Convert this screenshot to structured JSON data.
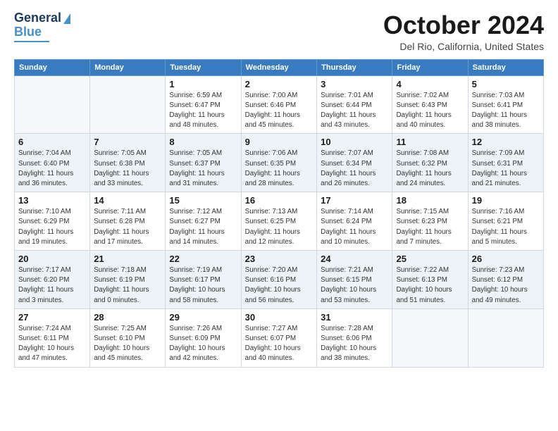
{
  "logo": {
    "line1": "General",
    "line2": "Blue"
  },
  "title": "October 2024",
  "location": "Del Rio, California, United States",
  "days_of_week": [
    "Sunday",
    "Monday",
    "Tuesday",
    "Wednesday",
    "Thursday",
    "Friday",
    "Saturday"
  ],
  "weeks": [
    [
      {
        "day": "",
        "info": ""
      },
      {
        "day": "",
        "info": ""
      },
      {
        "day": "1",
        "info": "Sunrise: 6:59 AM\nSunset: 6:47 PM\nDaylight: 11 hours and 48 minutes."
      },
      {
        "day": "2",
        "info": "Sunrise: 7:00 AM\nSunset: 6:46 PM\nDaylight: 11 hours and 45 minutes."
      },
      {
        "day": "3",
        "info": "Sunrise: 7:01 AM\nSunset: 6:44 PM\nDaylight: 11 hours and 43 minutes."
      },
      {
        "day": "4",
        "info": "Sunrise: 7:02 AM\nSunset: 6:43 PM\nDaylight: 11 hours and 40 minutes."
      },
      {
        "day": "5",
        "info": "Sunrise: 7:03 AM\nSunset: 6:41 PM\nDaylight: 11 hours and 38 minutes."
      }
    ],
    [
      {
        "day": "6",
        "info": "Sunrise: 7:04 AM\nSunset: 6:40 PM\nDaylight: 11 hours and 36 minutes."
      },
      {
        "day": "7",
        "info": "Sunrise: 7:05 AM\nSunset: 6:38 PM\nDaylight: 11 hours and 33 minutes."
      },
      {
        "day": "8",
        "info": "Sunrise: 7:05 AM\nSunset: 6:37 PM\nDaylight: 11 hours and 31 minutes."
      },
      {
        "day": "9",
        "info": "Sunrise: 7:06 AM\nSunset: 6:35 PM\nDaylight: 11 hours and 28 minutes."
      },
      {
        "day": "10",
        "info": "Sunrise: 7:07 AM\nSunset: 6:34 PM\nDaylight: 11 hours and 26 minutes."
      },
      {
        "day": "11",
        "info": "Sunrise: 7:08 AM\nSunset: 6:32 PM\nDaylight: 11 hours and 24 minutes."
      },
      {
        "day": "12",
        "info": "Sunrise: 7:09 AM\nSunset: 6:31 PM\nDaylight: 11 hours and 21 minutes."
      }
    ],
    [
      {
        "day": "13",
        "info": "Sunrise: 7:10 AM\nSunset: 6:29 PM\nDaylight: 11 hours and 19 minutes."
      },
      {
        "day": "14",
        "info": "Sunrise: 7:11 AM\nSunset: 6:28 PM\nDaylight: 11 hours and 17 minutes."
      },
      {
        "day": "15",
        "info": "Sunrise: 7:12 AM\nSunset: 6:27 PM\nDaylight: 11 hours and 14 minutes."
      },
      {
        "day": "16",
        "info": "Sunrise: 7:13 AM\nSunset: 6:25 PM\nDaylight: 11 hours and 12 minutes."
      },
      {
        "day": "17",
        "info": "Sunrise: 7:14 AM\nSunset: 6:24 PM\nDaylight: 11 hours and 10 minutes."
      },
      {
        "day": "18",
        "info": "Sunrise: 7:15 AM\nSunset: 6:23 PM\nDaylight: 11 hours and 7 minutes."
      },
      {
        "day": "19",
        "info": "Sunrise: 7:16 AM\nSunset: 6:21 PM\nDaylight: 11 hours and 5 minutes."
      }
    ],
    [
      {
        "day": "20",
        "info": "Sunrise: 7:17 AM\nSunset: 6:20 PM\nDaylight: 11 hours and 3 minutes."
      },
      {
        "day": "21",
        "info": "Sunrise: 7:18 AM\nSunset: 6:19 PM\nDaylight: 11 hours and 0 minutes."
      },
      {
        "day": "22",
        "info": "Sunrise: 7:19 AM\nSunset: 6:17 PM\nDaylight: 10 hours and 58 minutes."
      },
      {
        "day": "23",
        "info": "Sunrise: 7:20 AM\nSunset: 6:16 PM\nDaylight: 10 hours and 56 minutes."
      },
      {
        "day": "24",
        "info": "Sunrise: 7:21 AM\nSunset: 6:15 PM\nDaylight: 10 hours and 53 minutes."
      },
      {
        "day": "25",
        "info": "Sunrise: 7:22 AM\nSunset: 6:13 PM\nDaylight: 10 hours and 51 minutes."
      },
      {
        "day": "26",
        "info": "Sunrise: 7:23 AM\nSunset: 6:12 PM\nDaylight: 10 hours and 49 minutes."
      }
    ],
    [
      {
        "day": "27",
        "info": "Sunrise: 7:24 AM\nSunset: 6:11 PM\nDaylight: 10 hours and 47 minutes."
      },
      {
        "day": "28",
        "info": "Sunrise: 7:25 AM\nSunset: 6:10 PM\nDaylight: 10 hours and 45 minutes."
      },
      {
        "day": "29",
        "info": "Sunrise: 7:26 AM\nSunset: 6:09 PM\nDaylight: 10 hours and 42 minutes."
      },
      {
        "day": "30",
        "info": "Sunrise: 7:27 AM\nSunset: 6:07 PM\nDaylight: 10 hours and 40 minutes."
      },
      {
        "day": "31",
        "info": "Sunrise: 7:28 AM\nSunset: 6:06 PM\nDaylight: 10 hours and 38 minutes."
      },
      {
        "day": "",
        "info": ""
      },
      {
        "day": "",
        "info": ""
      }
    ]
  ]
}
